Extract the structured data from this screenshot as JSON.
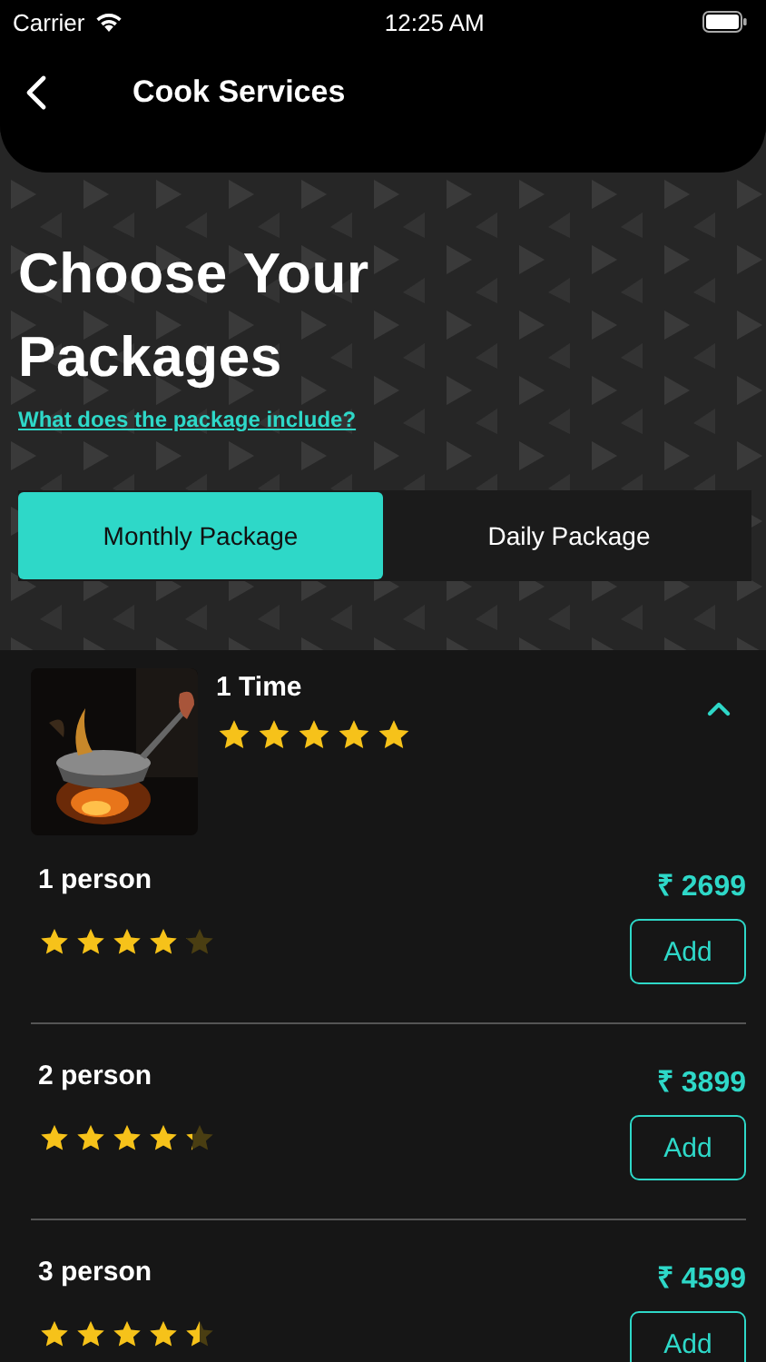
{
  "status_bar": {
    "carrier": "Carrier",
    "time": "12:25 AM"
  },
  "header": {
    "title": "Cook Services"
  },
  "heading": "Choose Your Packages",
  "info_link": "What does the package include?",
  "tabs": [
    {
      "label": "Monthly Package",
      "selected": true
    },
    {
      "label": "Daily Package",
      "selected": false
    }
  ],
  "package": {
    "kind": "picture",
    "title": "1 Time",
    "stars": 5,
    "expanded": true,
    "options": [
      {
        "name": "1 person",
        "price": "₹ 2699",
        "stars": 4.1,
        "button": "Add"
      },
      {
        "name": "2 person",
        "price": "₹ 3899",
        "stars": 4.3,
        "button": "Add"
      },
      {
        "name": "3 person",
        "price": "₹ 4599",
        "stars": 4.5,
        "button": "Add"
      }
    ]
  }
}
